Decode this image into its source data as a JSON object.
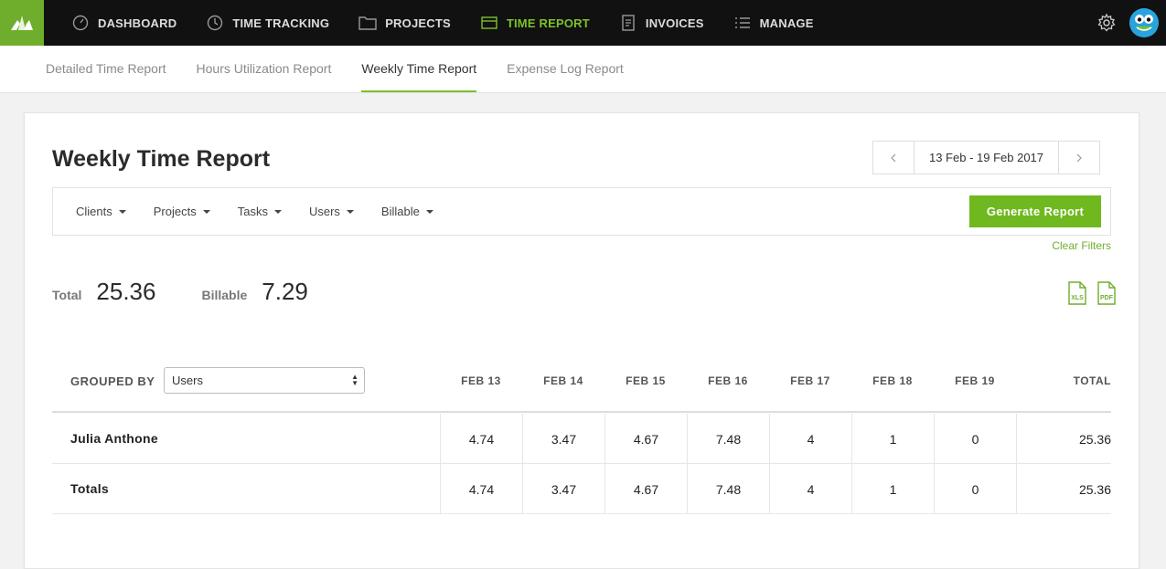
{
  "nav": {
    "items": [
      {
        "label": "DASHBOARD",
        "icon": "dashboard-icon"
      },
      {
        "label": "TIME TRACKING",
        "icon": "clock-icon"
      },
      {
        "label": "PROJECTS",
        "icon": "folder-icon"
      },
      {
        "label": "TIME REPORT",
        "icon": "report-icon",
        "active": true
      },
      {
        "label": "INVOICES",
        "icon": "invoice-icon"
      },
      {
        "label": "MANAGE",
        "icon": "list-icon"
      }
    ],
    "accent": "#7cc12b"
  },
  "subnav": {
    "tabs": [
      {
        "label": "Detailed Time Report"
      },
      {
        "label": "Hours Utilization Report"
      },
      {
        "label": "Weekly Time Report",
        "active": true
      },
      {
        "label": "Expense Log Report"
      }
    ]
  },
  "report": {
    "title": "Weekly Time Report",
    "date_range": "13 Feb - 19 Feb 2017",
    "filters": [
      "Clients",
      "Projects",
      "Tasks",
      "Users",
      "Billable"
    ],
    "generate_label": "Generate Report",
    "clear_filters_label": "Clear Filters",
    "total_label": "Total",
    "total_value": "25.36",
    "billable_label": "Billable",
    "billable_value": "7.29",
    "export_xls": "XLS",
    "export_pdf": "PDF"
  },
  "table": {
    "grouped_by_label": "GROUPED BY",
    "grouped_by_value": "Users",
    "columns": [
      "FEB 13",
      "FEB 14",
      "FEB 15",
      "FEB 16",
      "FEB 17",
      "FEB 18",
      "FEB 19"
    ],
    "total_header": "TOTAL",
    "rows": [
      {
        "label": "Julia Anthone",
        "values": [
          "4.74",
          "3.47",
          "4.67",
          "7.48",
          "4",
          "1",
          "0"
        ],
        "total": "25.36"
      },
      {
        "label": "Totals",
        "values": [
          "4.74",
          "3.47",
          "4.67",
          "7.48",
          "4",
          "1",
          "0"
        ],
        "total": "25.36"
      }
    ]
  }
}
